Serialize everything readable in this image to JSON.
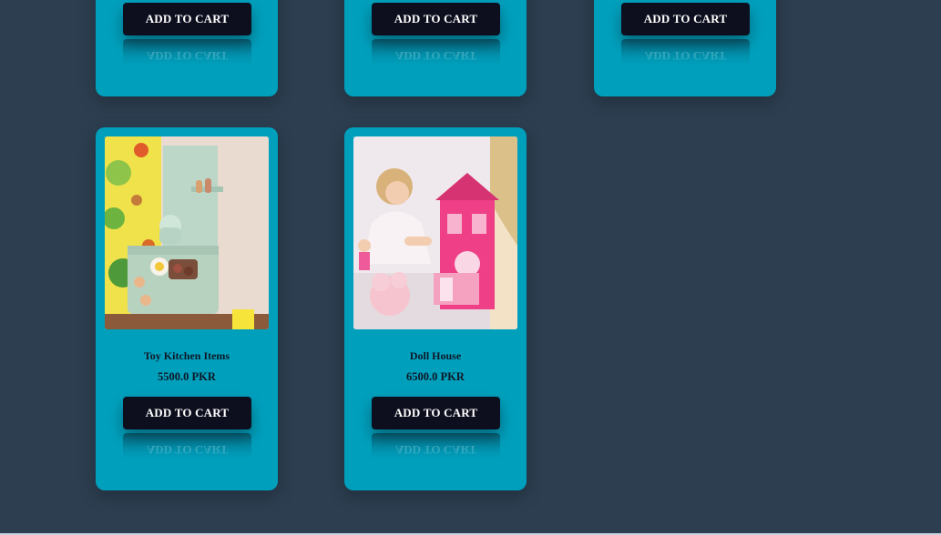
{
  "top_row": [
    {
      "button_label": "ADD TO CART"
    },
    {
      "button_label": "ADD TO CART"
    },
    {
      "button_label": "ADD TO CART"
    }
  ],
  "products": [
    {
      "title": "Toy Kitchen Items",
      "price": "5500.0 PKR",
      "button_label": "ADD TO CART"
    },
    {
      "title": "Doll House",
      "price": "6500.0 PKR",
      "button_label": "ADD TO CART"
    }
  ],
  "colors": {
    "background": "#2c3e50",
    "card": "#00a0bd",
    "button": "#0d0f1e"
  }
}
